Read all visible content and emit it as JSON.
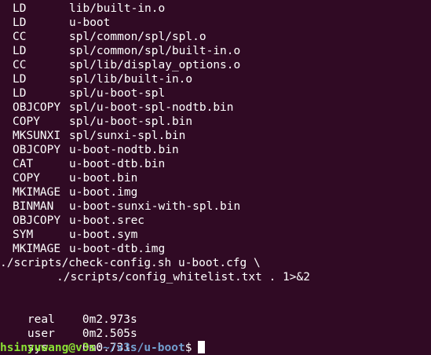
{
  "terminal": {
    "build_lines": [
      {
        "action": "LD",
        "target": "lib/built-in.o"
      },
      {
        "action": "LD",
        "target": "u-boot"
      },
      {
        "action": "CC",
        "target": "spl/common/spl/spl.o"
      },
      {
        "action": "LD",
        "target": "spl/common/spl/built-in.o"
      },
      {
        "action": "CC",
        "target": "spl/lib/display_options.o"
      },
      {
        "action": "LD",
        "target": "spl/lib/built-in.o"
      },
      {
        "action": "LD",
        "target": "spl/u-boot-spl"
      },
      {
        "action": "OBJCOPY",
        "target": "spl/u-boot-spl-nodtb.bin"
      },
      {
        "action": "COPY",
        "target": "spl/u-boot-spl.bin"
      },
      {
        "action": "MKSUNXI",
        "target": "spl/sunxi-spl.bin"
      },
      {
        "action": "OBJCOPY",
        "target": "u-boot-nodtb.bin"
      },
      {
        "action": "CAT",
        "target": "u-boot-dtb.bin"
      },
      {
        "action": "COPY",
        "target": "u-boot.bin"
      },
      {
        "action": "MKIMAGE",
        "target": "u-boot.img"
      },
      {
        "action": "BINMAN",
        "target": "u-boot-sunxi-with-spl.bin"
      },
      {
        "action": "OBJCOPY",
        "target": "u-boot.srec"
      },
      {
        "action": "SYM",
        "target": "u-boot.sym"
      },
      {
        "action": "MKIMAGE",
        "target": "u-boot-dtb.img"
      }
    ],
    "check_config": "./scripts/check-config.sh u-boot.cfg \\",
    "check_config_cont": "./scripts/config_whitelist.txt . 1>&2",
    "timing": [
      {
        "label": "real",
        "value": "0m2.973s"
      },
      {
        "label": "user",
        "value": "0m2.505s"
      },
      {
        "label": "sys",
        "value": "0m0.731s"
      }
    ],
    "prompt": {
      "user_host": "hsinyuwang@v3s",
      "separator": ":",
      "path": "~/v3s/u-boot",
      "dollar": "$"
    },
    "colors": {
      "background": "#300a24",
      "text": "#ffffff",
      "user_host": "#8ae234",
      "path": "#729fcf"
    }
  }
}
